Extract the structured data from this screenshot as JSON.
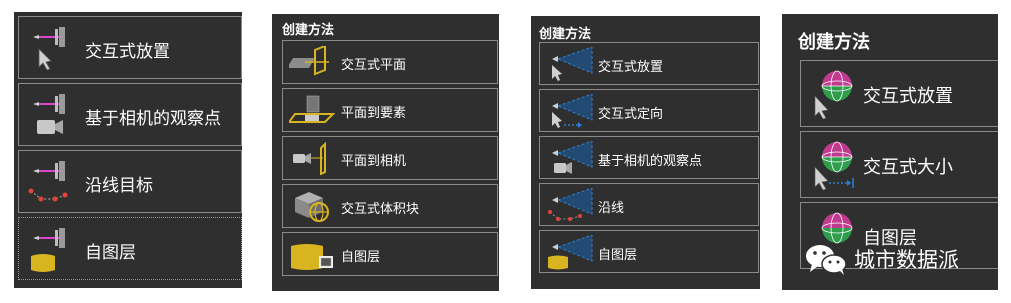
{
  "panel1": {
    "items": [
      {
        "label": "交互式放置",
        "icon": "camera-target-cursor-icon"
      },
      {
        "label": "基于相机的观察点",
        "icon": "camera-target-camera-icon"
      },
      {
        "label": "沿线目标",
        "icon": "camera-target-line-icon"
      },
      {
        "label": "自图层",
        "icon": "camera-target-layer-icon"
      }
    ]
  },
  "panel2": {
    "title": "创建方法",
    "items": [
      {
        "label": "交互式平面",
        "icon": "interactive-plane-icon"
      },
      {
        "label": "平面到要素",
        "icon": "plane-to-feature-icon"
      },
      {
        "label": "平面到相机",
        "icon": "plane-to-camera-icon"
      },
      {
        "label": "交互式体积块",
        "icon": "interactive-volume-icon"
      },
      {
        "label": "自图层",
        "icon": "from-layer-icon"
      }
    ]
  },
  "panel3": {
    "title": "创建方法",
    "items": [
      {
        "label": "交互式放置",
        "icon": "viewshed-cursor-icon"
      },
      {
        "label": "交互式定向",
        "icon": "viewshed-orient-icon"
      },
      {
        "label": "基于相机的观察点",
        "icon": "viewshed-camera-icon"
      },
      {
        "label": "沿线",
        "icon": "viewshed-line-icon"
      },
      {
        "label": "自图层",
        "icon": "viewshed-layer-icon"
      }
    ]
  },
  "panel4": {
    "title": "创建方法",
    "items": [
      {
        "label": "交互式放置",
        "icon": "sphere-cursor-icon"
      },
      {
        "label": "交互式大小",
        "icon": "sphere-size-icon"
      },
      {
        "label": "自图层",
        "icon": "sphere-layer-icon"
      }
    ]
  },
  "watermark": {
    "text": "城市数据派",
    "icon": "wechat-icon"
  },
  "colors": {
    "panel_bg": "#2f2f2f",
    "border": "#8a8a8a",
    "magenta": "#d946c8",
    "yellow": "#d7b420",
    "blue": "#2f7fd0"
  }
}
